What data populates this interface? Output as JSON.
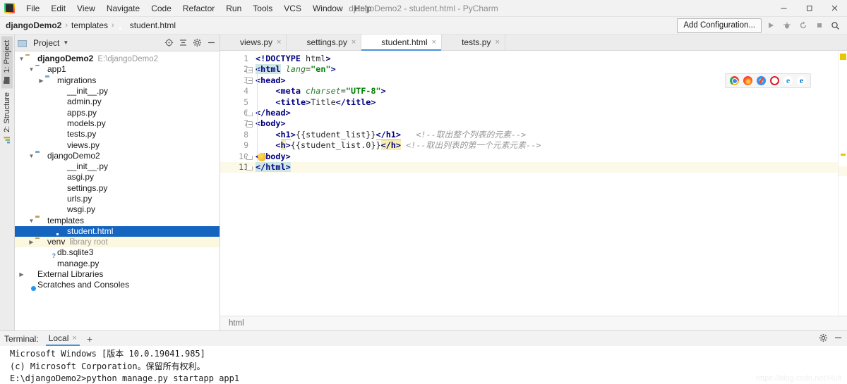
{
  "window": {
    "title": "djangoDemo2 - student.html - PyCharm",
    "logo_icon": "pycharm-logo-icon",
    "minimize_icon": "minimize-icon",
    "maximize_icon": "maximize-icon",
    "close_icon": "close-icon"
  },
  "menubar": {
    "items": [
      {
        "label": "File"
      },
      {
        "label": "Edit"
      },
      {
        "label": "View"
      },
      {
        "label": "Navigate"
      },
      {
        "label": "Code"
      },
      {
        "label": "Refactor"
      },
      {
        "label": "Run"
      },
      {
        "label": "Tools"
      },
      {
        "label": "VCS"
      },
      {
        "label": "Window"
      },
      {
        "label": "Help"
      }
    ]
  },
  "navbar": {
    "crumbs": [
      {
        "label": "djangoDemo2"
      },
      {
        "label": "templates"
      },
      {
        "label": "student.html"
      }
    ],
    "separator": "›",
    "add_configuration": "Add Configuration...",
    "run_icon": "run-icon",
    "debug_icon": "debug-icon",
    "coverage_icon": "run-coverage-icon",
    "stop_icon": "stop-icon",
    "search_icon": "search-everywhere-icon"
  },
  "rail": {
    "tabs": [
      {
        "label": "1: Project",
        "icon": "project-icon",
        "selected": true
      },
      {
        "label": "2: Structure",
        "icon": "structure-icon",
        "selected": false
      }
    ]
  },
  "project_panel": {
    "title": "Project",
    "dropdown_icon": "chevron-down-icon",
    "locate_icon": "select-opened-file-icon",
    "collapse_icon": "collapse-all-icon",
    "settings_icon": "gear-icon",
    "hide_icon": "hide-panel-icon",
    "tree": [
      {
        "label": "djangoDemo2",
        "sub": "E:\\djangoDemo2",
        "depth": 0,
        "arrow": "down",
        "icon": "folder-icon",
        "bold": true
      },
      {
        "label": "app1",
        "sub": "",
        "depth": 1,
        "arrow": "down",
        "icon": "folder-source-icon",
        "bold": false
      },
      {
        "label": "migrations",
        "sub": "",
        "depth": 2,
        "arrow": "right",
        "icon": "folder-source-icon",
        "bold": false
      },
      {
        "label": "__init__.py",
        "sub": "",
        "depth": 3,
        "arrow": "none",
        "icon": "python-file-icon",
        "bold": false
      },
      {
        "label": "admin.py",
        "sub": "",
        "depth": 3,
        "arrow": "none",
        "icon": "python-file-icon",
        "bold": false
      },
      {
        "label": "apps.py",
        "sub": "",
        "depth": 3,
        "arrow": "none",
        "icon": "python-file-icon",
        "bold": false
      },
      {
        "label": "models.py",
        "sub": "",
        "depth": 3,
        "arrow": "none",
        "icon": "python-file-icon",
        "bold": false
      },
      {
        "label": "tests.py",
        "sub": "",
        "depth": 3,
        "arrow": "none",
        "icon": "python-file-icon",
        "bold": false
      },
      {
        "label": "views.py",
        "sub": "",
        "depth": 3,
        "arrow": "none",
        "icon": "python-file-icon",
        "bold": false
      },
      {
        "label": "djangoDemo2",
        "sub": "",
        "depth": 1,
        "arrow": "down",
        "icon": "folder-source-icon",
        "bold": false
      },
      {
        "label": "__init__.py",
        "sub": "",
        "depth": 3,
        "arrow": "none",
        "icon": "python-file-icon",
        "bold": false
      },
      {
        "label": "asgi.py",
        "sub": "",
        "depth": 3,
        "arrow": "none",
        "icon": "python-file-icon",
        "bold": false
      },
      {
        "label": "settings.py",
        "sub": "",
        "depth": 3,
        "arrow": "none",
        "icon": "python-file-icon",
        "bold": false
      },
      {
        "label": "urls.py",
        "sub": "",
        "depth": 3,
        "arrow": "none",
        "icon": "python-file-icon",
        "bold": false
      },
      {
        "label": "wsgi.py",
        "sub": "",
        "depth": 3,
        "arrow": "none",
        "icon": "python-file-icon",
        "bold": false
      },
      {
        "label": "templates",
        "sub": "",
        "depth": 1,
        "arrow": "down",
        "icon": "folder-icon",
        "bold": false
      },
      {
        "label": "student.html",
        "sub": "",
        "depth": 3,
        "arrow": "none",
        "icon": "html-file-icon",
        "bold": false,
        "selected": true
      },
      {
        "label": "venv",
        "sub": "library root",
        "depth": 1,
        "arrow": "right",
        "icon": "folder-icon",
        "bold": false,
        "highlight": true
      },
      {
        "label": "db.sqlite3",
        "sub": "",
        "depth": 2,
        "arrow": "none",
        "icon": "database-file-icon",
        "bold": false
      },
      {
        "label": "manage.py",
        "sub": "",
        "depth": 2,
        "arrow": "none",
        "icon": "python-file-icon",
        "bold": false
      },
      {
        "label": "External Libraries",
        "sub": "",
        "depth": 0,
        "arrow": "right",
        "icon": "libraries-icon",
        "bold": false
      },
      {
        "label": "Scratches and Consoles",
        "sub": "",
        "depth": 0,
        "arrow": "none",
        "icon": "scratches-icon",
        "bold": false
      }
    ]
  },
  "editor": {
    "tabs": [
      {
        "label": "views.py",
        "icon": "python-file-icon",
        "active": false
      },
      {
        "label": "settings.py",
        "icon": "python-file-icon",
        "active": false
      },
      {
        "label": "student.html",
        "icon": "html-file-icon",
        "active": true
      },
      {
        "label": "tests.py",
        "icon": "python-file-icon",
        "active": false
      }
    ],
    "close_glyph": "×",
    "current_line": 11,
    "line_numbers": [
      "1",
      "2",
      "3",
      "4",
      "5",
      "6",
      "7",
      "8",
      "9",
      "10",
      "11"
    ],
    "lines": [
      {
        "n": 1,
        "text": "<!DOCTYPE html>"
      },
      {
        "n": 2,
        "text": "<html lang=\"en\">"
      },
      {
        "n": 3,
        "text": "<head>"
      },
      {
        "n": 4,
        "text": "    <meta charset=\"UTF-8\">"
      },
      {
        "n": 5,
        "text": "    <title>Title</title>"
      },
      {
        "n": 6,
        "text": "</head>"
      },
      {
        "n": 7,
        "text": "<body>"
      },
      {
        "n": 8,
        "text": "    <h1>{{student_list}}</h1>   <!--取出整个列表的元素-->"
      },
      {
        "n": 9,
        "text": "    <h>{{student_list.0}}</h> <!--取出列表的第一个元素元素-->"
      },
      {
        "n": 10,
        "text": "</body>"
      },
      {
        "n": 11,
        "text": "</html>"
      }
    ],
    "code_tokens": {
      "l1": {
        "tag_open": "<!DOCTYPE",
        "name": " html",
        "close": ">"
      },
      "l2": {
        "open": "<",
        "tag": "html",
        "attr": " lang",
        "eq": "=",
        "val": "\"en\"",
        "close": ">"
      },
      "l3": {
        "open": "<",
        "tag": "head",
        "close": ">"
      },
      "l4": {
        "indent": "    ",
        "open": "<",
        "tag": "meta",
        "attr": " charset",
        "eq": "=",
        "val": "\"UTF-8\"",
        "close": ">"
      },
      "l5": {
        "indent": "    ",
        "open": "<",
        "tag": "title",
        "close": ">",
        "text": "Title",
        "end": "</title>"
      },
      "l6": {
        "end": "</head>"
      },
      "l7": {
        "open": "<",
        "tag": "body",
        "close": ">"
      },
      "l8": {
        "indent": "    ",
        "open": "<",
        "tag": "h1",
        "close": ">",
        "expr": "{{student_list}}",
        "end": "</h1>",
        "gap": "   ",
        "comment": "<!--取出整个列表的元素-->"
      },
      "l9": {
        "indent": "    ",
        "open": "<",
        "tag": "h",
        "close": ">",
        "expr": "{{student_list.0}}",
        "end": "</h>",
        "gap": " ",
        "comment": "<!--取出列表的第一个元素元素-->"
      },
      "l10": {
        "end": "</body>"
      },
      "l11": {
        "end": "</html>"
      }
    },
    "browser_bar": {
      "icons": [
        {
          "name": "chrome-icon",
          "glyph": ""
        },
        {
          "name": "firefox-icon",
          "glyph": ""
        },
        {
          "name": "safari-icon",
          "glyph": ""
        },
        {
          "name": "opera-icon",
          "glyph": ""
        },
        {
          "name": "internet-explorer-icon",
          "glyph": "e"
        },
        {
          "name": "edge-icon",
          "glyph": "e"
        }
      ]
    },
    "breadcrumb_status": "html",
    "inspection_marker_color": "#e8c700",
    "lightbulb_line": 10
  },
  "terminal": {
    "label": "Terminal:",
    "tab": "Local",
    "close_glyph": "×",
    "add_glyph": "+",
    "settings_icon": "gear-icon",
    "hide_icon": "hide-panel-icon",
    "lines": [
      "Microsoft Windows [版本 10.0.19041.985]",
      "(c) Microsoft Corporation。保留所有权利。",
      "E:\\djangoDemo2>python manage.py startapp app1"
    ],
    "watermark": "https://blog.csdn.net/Hult"
  },
  "colors": {
    "accent": "#4a90d9",
    "selection": "#1565c0",
    "warning": "#e8c700",
    "tag": "#000080",
    "attr": "#2a7d2a",
    "value": "#008000",
    "comment": "#969696"
  }
}
